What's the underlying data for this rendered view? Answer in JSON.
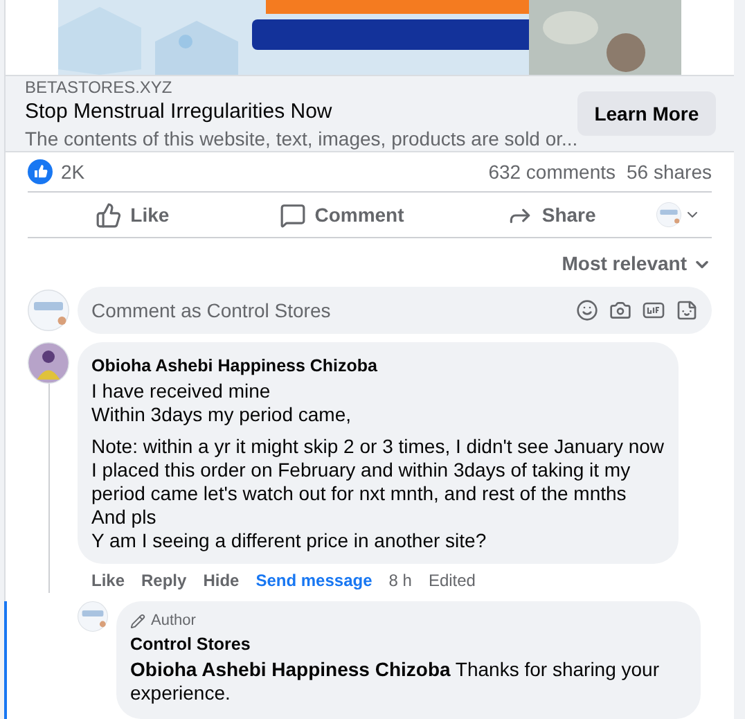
{
  "ad": {
    "domain": "BETASTORES.XYZ",
    "headline": "Stop Menstrual Irregularities Now",
    "description": "The contents of this website, text, images, products are sold or...",
    "cta": "Learn More"
  },
  "stats": {
    "reactions": "2K",
    "comments": "632 comments",
    "shares": "56 shares"
  },
  "actions": [
    {
      "kind": "like",
      "label": "Like"
    },
    {
      "kind": "comment",
      "label": "Comment"
    },
    {
      "kind": "share",
      "label": "Share"
    }
  ],
  "sort": "Most relevant",
  "composer": {
    "placeholder": "Comment as Control Stores"
  },
  "comment": {
    "author": "Obioha Ashebi Happiness Chizoba",
    "paragraphs": [
      [
        "I have received mine",
        "Within 3days my period came,"
      ],
      [
        "Note: within a yr it might skip 2 or 3 times, I didn't see January now I placed this order on February and within 3days of taking it my period came let's watch out for nxt mnth, and rest of the mnths",
        "And pls",
        "Y am I seeing a different price in another site?"
      ]
    ],
    "links": [
      {
        "kind": "plain",
        "label": "Like"
      },
      {
        "kind": "plain",
        "label": "Reply"
      },
      {
        "kind": "plain",
        "label": "Hide"
      },
      {
        "kind": "accent",
        "label": "Send message"
      }
    ],
    "time": "8 h",
    "edited": "Edited",
    "reply": {
      "badge": "Author",
      "author": "Control Stores",
      "text": "**Obioha Ashebi Happiness Chizoba** Thanks for sharing your experience."
    }
  }
}
